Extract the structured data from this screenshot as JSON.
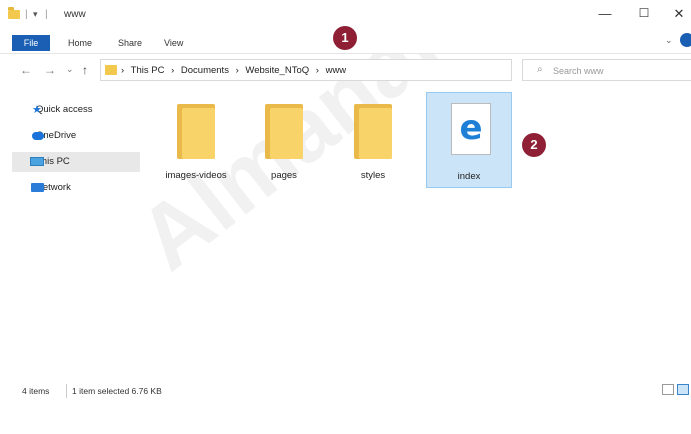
{
  "window": {
    "title": "www",
    "title_separator": "|",
    "qat_icon": "quick-access-toolbar-down-arrow",
    "minimize": "—",
    "maximize": "☐",
    "close": "✕"
  },
  "ribbon": {
    "tabs": [
      "File",
      "Home",
      "Share",
      "View"
    ]
  },
  "address": {
    "back": "←",
    "forward": "→",
    "recent": "⌄",
    "up": "↑",
    "crumbs": [
      "This PC",
      "Documents",
      "Website_NToQ",
      "www"
    ],
    "crumb_separator": "›",
    "dropdown": "⌄",
    "refresh": "↻"
  },
  "search": {
    "placeholder": "Search www",
    "icon": "search-icon"
  },
  "sidebar": {
    "items": [
      {
        "label": "Quick access",
        "icon": "star-icon",
        "color": "#1a73d9"
      },
      {
        "label": "OneDrive",
        "icon": "cloud-icon",
        "color": "#1a73d9"
      },
      {
        "label": "This PC",
        "icon": "computer-icon",
        "color": "#4aa3df",
        "selected": true
      },
      {
        "label": "Network",
        "icon": "network-icon",
        "color": "#2b7bd8"
      }
    ]
  },
  "files": [
    {
      "name": "images-videos",
      "type": "folder"
    },
    {
      "name": "pages",
      "type": "folder"
    },
    {
      "name": "styles",
      "type": "folder"
    },
    {
      "name": "index",
      "type": "html",
      "icon": "edge-icon",
      "selected": true
    }
  ],
  "markers": [
    {
      "label": "1"
    },
    {
      "label": "2"
    }
  ],
  "status": {
    "count": "4 items",
    "selection": "1 item selected  6.76 KB"
  },
  "watermark": "Almanahij.com",
  "colors": {
    "accent": "#1a5fb4",
    "marker": "#8e1f34",
    "folder": "#f7d36a",
    "selection": "#cce4f7"
  }
}
